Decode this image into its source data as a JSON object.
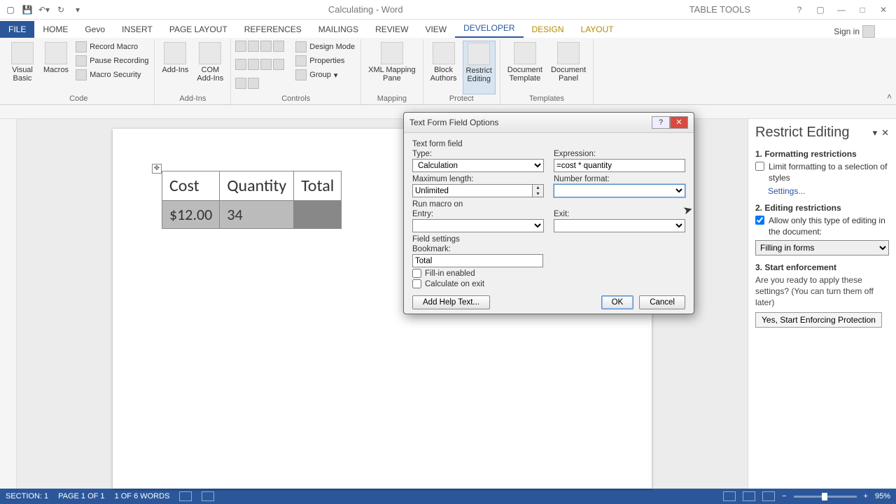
{
  "titlebar": {
    "title": "Calculating - Word",
    "contextual": "TABLE TOOLS"
  },
  "tabs": {
    "file": "FILE",
    "home": "HOME",
    "gevo": "Gevo",
    "insert": "INSERT",
    "pagelayout": "PAGE LAYOUT",
    "references": "REFERENCES",
    "mailings": "MAILINGS",
    "review": "REVIEW",
    "view": "VIEW",
    "developer": "DEVELOPER",
    "design": "DESIGN",
    "layout": "LAYOUT",
    "signin": "Sign in"
  },
  "ribbon": {
    "code": {
      "vb": "Visual\nBasic",
      "macros": "Macros",
      "record": "Record Macro",
      "pause": "Pause Recording",
      "security": "Macro Security",
      "label": "Code"
    },
    "addins": {
      "addins": "Add-Ins",
      "com": "COM\nAdd-Ins",
      "label": "Add-Ins"
    },
    "controls": {
      "design": "Design Mode",
      "props": "Properties",
      "group": "Group",
      "label": "Controls"
    },
    "mapping": {
      "xml": "XML Mapping\nPane",
      "label": "Mapping"
    },
    "protect": {
      "block": "Block\nAuthors",
      "restrict": "Restrict\nEditing",
      "label": "Protect"
    },
    "templates": {
      "doctpl": "Document\nTemplate",
      "docpanel": "Document\nPanel",
      "label": "Templates"
    }
  },
  "doc": {
    "headers": [
      "Cost",
      "Quantity",
      "Total"
    ],
    "row": [
      "$12.00",
      "34",
      ""
    ]
  },
  "dialog": {
    "title": "Text Form Field Options",
    "section1": "Text form field",
    "type_label": "Type:",
    "type_value": "Calculation",
    "expr_label": "Expression:",
    "expr_value": "=cost * quantity",
    "maxlen_label": "Maximum length:",
    "maxlen_value": "Unlimited",
    "numfmt_label": "Number format:",
    "numfmt_value": "",
    "section2": "Run macro on",
    "entry_label": "Entry:",
    "entry_value": "",
    "exit_label": "Exit:",
    "exit_value": "",
    "section3": "Field settings",
    "bookmark_label": "Bookmark:",
    "bookmark_value": "Total",
    "fillin": "Fill-in enabled",
    "calc": "Calculate on exit",
    "addhelp": "Add Help Text...",
    "ok": "OK",
    "cancel": "Cancel"
  },
  "pane": {
    "title": "Restrict Editing",
    "s1": "1. Formatting restrictions",
    "s1_chk": "Limit formatting to a selection of styles",
    "s1_link": "Settings...",
    "s2": "2. Editing restrictions",
    "s2_chk": "Allow only this type of editing in the document:",
    "s2_sel": "Filling in forms",
    "s3": "3. Start enforcement",
    "s3_desc": "Are you ready to apply these settings? (You can turn them off later)",
    "s3_btn": "Yes, Start Enforcing Protection"
  },
  "status": {
    "section": "SECTION: 1",
    "page": "PAGE 1 OF 1",
    "words": "1 OF 6 WORDS",
    "zoom": "95%"
  }
}
